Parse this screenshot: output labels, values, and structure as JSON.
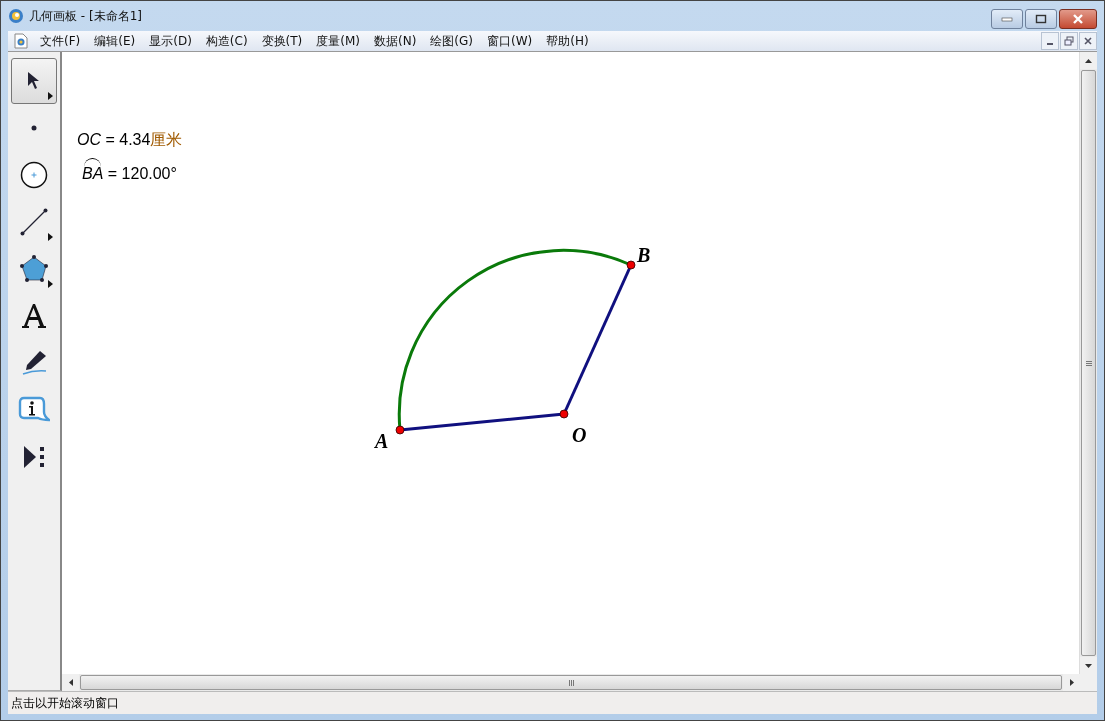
{
  "window": {
    "title": "几何画板 - [未命名1]"
  },
  "menu": [
    "文件(F)",
    "编辑(E)",
    "显示(D)",
    "构造(C)",
    "变换(T)",
    "度量(M)",
    "数据(N)",
    "绘图(G)",
    "窗口(W)",
    "帮助(H)"
  ],
  "tools": [
    {
      "kind": "arrow",
      "selected": true,
      "has_submenu": true
    },
    {
      "kind": "point",
      "selected": false,
      "has_submenu": false
    },
    {
      "kind": "compass",
      "selected": false,
      "has_submenu": false
    },
    {
      "kind": "line",
      "selected": false,
      "has_submenu": true
    },
    {
      "kind": "polygon",
      "selected": false,
      "has_submenu": true
    },
    {
      "kind": "text",
      "selected": false,
      "has_submenu": false
    },
    {
      "kind": "marker",
      "selected": false,
      "has_submenu": false
    },
    {
      "kind": "info",
      "selected": false,
      "has_submenu": false
    },
    {
      "kind": "custom",
      "selected": false,
      "has_submenu": false
    }
  ],
  "measurements": [
    {
      "kind": "distance",
      "name": "OC",
      "value": "= 4.34",
      "unit": "厘米"
    },
    {
      "kind": "arc",
      "name": "BA",
      "value": "= 120.00°"
    }
  ],
  "points": [
    {
      "label": "A"
    },
    {
      "label": "O"
    },
    {
      "label": "B"
    }
  ],
  "status_bar": "点击以开始滚动窗口"
}
